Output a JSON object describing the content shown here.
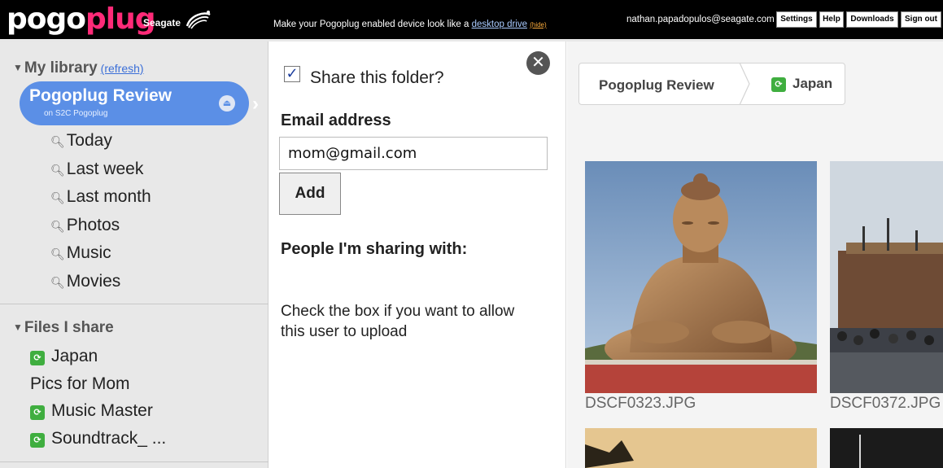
{
  "header": {
    "logo_pogo": "pogo",
    "logo_plug": "plug",
    "brand": "Seagate",
    "promo_text": "Make your Pogoplug enabled device look like a",
    "promo_link": "desktop drive",
    "promo_hide": "(hide)",
    "user_email": "nathan.papadopulos@seagate.com",
    "buttons": {
      "settings": "Settings",
      "help": "Help",
      "downloads": "Downloads",
      "sign_out": "Sign out"
    }
  },
  "sidebar": {
    "library_title": "My library",
    "refresh": "(refresh)",
    "device_name": "Pogoplug Review",
    "device_sub": "on S2C Pogoplug",
    "searches": [
      "Today",
      "Last week",
      "Last month",
      "Photos",
      "Music",
      "Movies"
    ],
    "shares_title": "Files I share",
    "shares": [
      "Japan",
      "Pics for Mom",
      "Music Master",
      "Soundtrack_ ..."
    ]
  },
  "share_panel": {
    "checkbox_label": "Share this folder?",
    "email_label": "Email address",
    "email_value": "mom@gmail.com",
    "add_label": "Add",
    "people_title": "People I'm sharing with:",
    "help_text": "Check the box if you want to allow this user to upload"
  },
  "main": {
    "breadcrumb": [
      "Pogoplug Review",
      "Japan"
    ],
    "photos": [
      "DSCF0323.JPG",
      "DSCF0372.JPG"
    ]
  },
  "colors": {
    "accent_pink": "#ff2a78",
    "device_blue": "#5b8fe6",
    "share_green": "#3fae3f"
  }
}
